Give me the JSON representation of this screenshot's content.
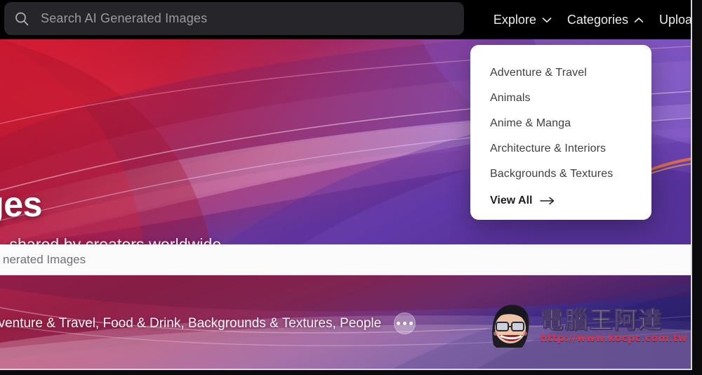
{
  "header": {
    "search": {
      "placeholder": "Search AI Generated Images",
      "icon": "search-icon"
    },
    "nav": [
      {
        "label": "Explore",
        "icon": "chevron-down-icon"
      },
      {
        "label": "Categories",
        "icon": "chevron-up-icon"
      },
      {
        "label": "Uploa",
        "icon": ""
      }
    ]
  },
  "hero": {
    "title": "mages",
    "subtitle": "ated images, shared by creators worldwide"
  },
  "dropdown": {
    "items": [
      {
        "label": "Adventure & Travel"
      },
      {
        "label": "Animals"
      },
      {
        "label": "Anime & Manga"
      },
      {
        "label": "Architecture & Interiors"
      },
      {
        "label": "Backgrounds & Textures"
      }
    ],
    "view_all": {
      "label": "View All",
      "icon": "arrow-right-icon"
    }
  },
  "strip": {
    "search_text": "nerated Images"
  },
  "band": {
    "tags_text": "dventure & Travel, Food & Drink, Backgrounds & Textures, People",
    "more_button": "more-options-button"
  },
  "watermark": {
    "brand": "電腦王阿達",
    "url": "http://www.kocpc.com.tw"
  },
  "colors": {
    "header_bg": "#000000",
    "search_bg": "#26262a",
    "hero_red": "#c0142c",
    "hero_purple": "#6b3fa0",
    "dropdown_bg": "#ffffff",
    "strip_bg": "#fbfbfc",
    "watermark_red": "#d4354e"
  }
}
